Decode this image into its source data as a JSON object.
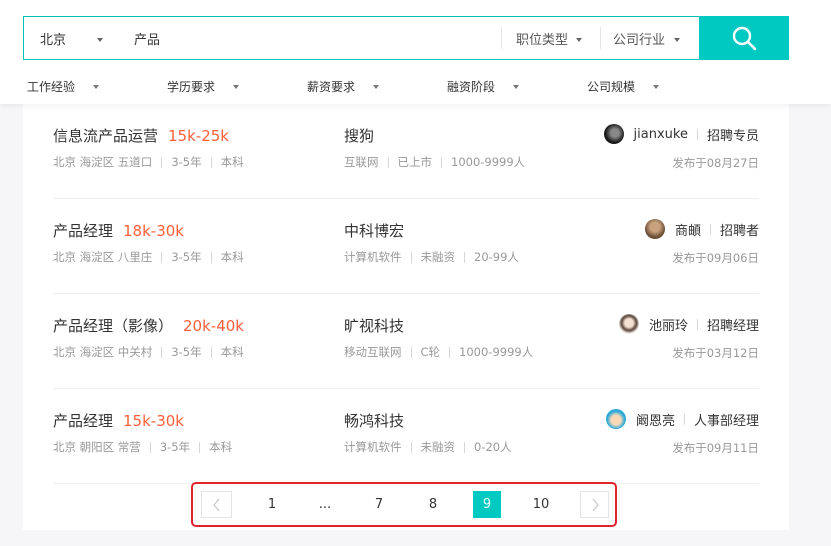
{
  "search": {
    "city": "北京",
    "keyword": "产品",
    "job_type_label": "职位类型",
    "industry_label": "公司行业",
    "search_icon": "search-icon"
  },
  "filters": [
    {
      "label": "工作经验"
    },
    {
      "label": "学历要求"
    },
    {
      "label": "薪资要求"
    },
    {
      "label": "融资阶段"
    },
    {
      "label": "公司规模"
    }
  ],
  "jobs": [
    {
      "title": "信息流产品运营",
      "salary": "15k-25k",
      "location": "北京 海淀区 五道口",
      "experience": "3-5年",
      "education": "本科",
      "company": "搜狗",
      "industry": "互联网",
      "stage": "已上市",
      "size": "1000-9999人",
      "recruiter_name": "jianxuke",
      "recruiter_role": "招聘专员",
      "posted": "发布于08月27日",
      "avatar_color": "#2a2a2a"
    },
    {
      "title": "产品经理",
      "salary": "18k-30k",
      "location": "北京 海淀区 八里庄",
      "experience": "3-5年",
      "education": "本科",
      "company": "中科博宏",
      "industry": "计算机软件",
      "stage": "未融资",
      "size": "20-99人",
      "recruiter_name": "商頔",
      "recruiter_role": "招聘者",
      "posted": "发布于09月06日",
      "avatar_color": "#9c7a5a"
    },
    {
      "title": "产品经理（影像）",
      "salary": "20k-40k",
      "location": "北京 海淀区 中关村",
      "experience": "3-5年",
      "education": "本科",
      "company": "旷视科技",
      "industry": "移动互联网",
      "stage": "C轮",
      "size": "1000-9999人",
      "recruiter_name": "池丽玲",
      "recruiter_role": "招聘经理",
      "posted": "发布于03月12日",
      "avatar_color": "#e8d6c8"
    },
    {
      "title": "产品经理",
      "salary": "15k-30k",
      "location": "北京 朝阳区 常营",
      "experience": "3-5年",
      "education": "本科",
      "company": "畅鸿科技",
      "industry": "计算机软件",
      "stage": "未融资",
      "size": "0-20人",
      "recruiter_name": "阚恩亮",
      "recruiter_role": "人事部经理",
      "posted": "发布于09月11日",
      "avatar_color": "#2aa8d8"
    }
  ],
  "pagination": {
    "pages": [
      "1",
      "...",
      "7",
      "8",
      "9",
      "10"
    ],
    "current": "9"
  },
  "colors": {
    "accent": "#00c9c1",
    "salary": "#fd5f39",
    "highlight_outline": "#e0242b"
  }
}
